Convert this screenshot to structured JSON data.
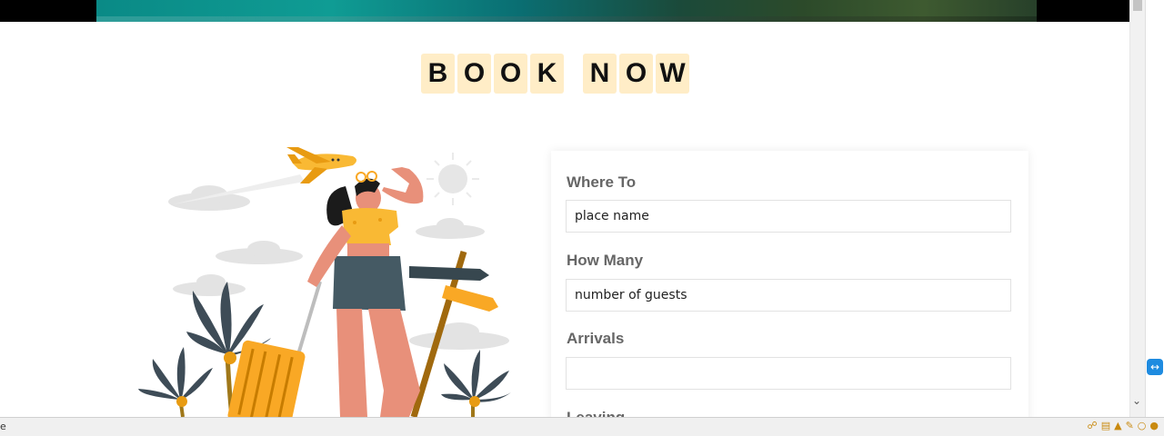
{
  "heading": {
    "letters_1": [
      "B",
      "O",
      "O",
      "K"
    ],
    "letters_2": [
      "N",
      "O",
      "W"
    ]
  },
  "form": {
    "where_label": "Where To",
    "where_placeholder": "place name",
    "how_many_label": "How Many",
    "how_many_placeholder": "number of guests",
    "arrivals_label": "Arrivals",
    "arrivals_value": "",
    "leaving_label": "Leaving"
  },
  "statusbar": {
    "text": "e"
  },
  "colors": {
    "tile_bg": "#ffedc7",
    "label_color": "#666666",
    "accent": "#f9a825"
  },
  "icons": [
    "airplane-icon",
    "sun-icon",
    "palm-tree-icon",
    "signpost-icon",
    "suitcase-icon",
    "teamviewer-icon"
  ]
}
